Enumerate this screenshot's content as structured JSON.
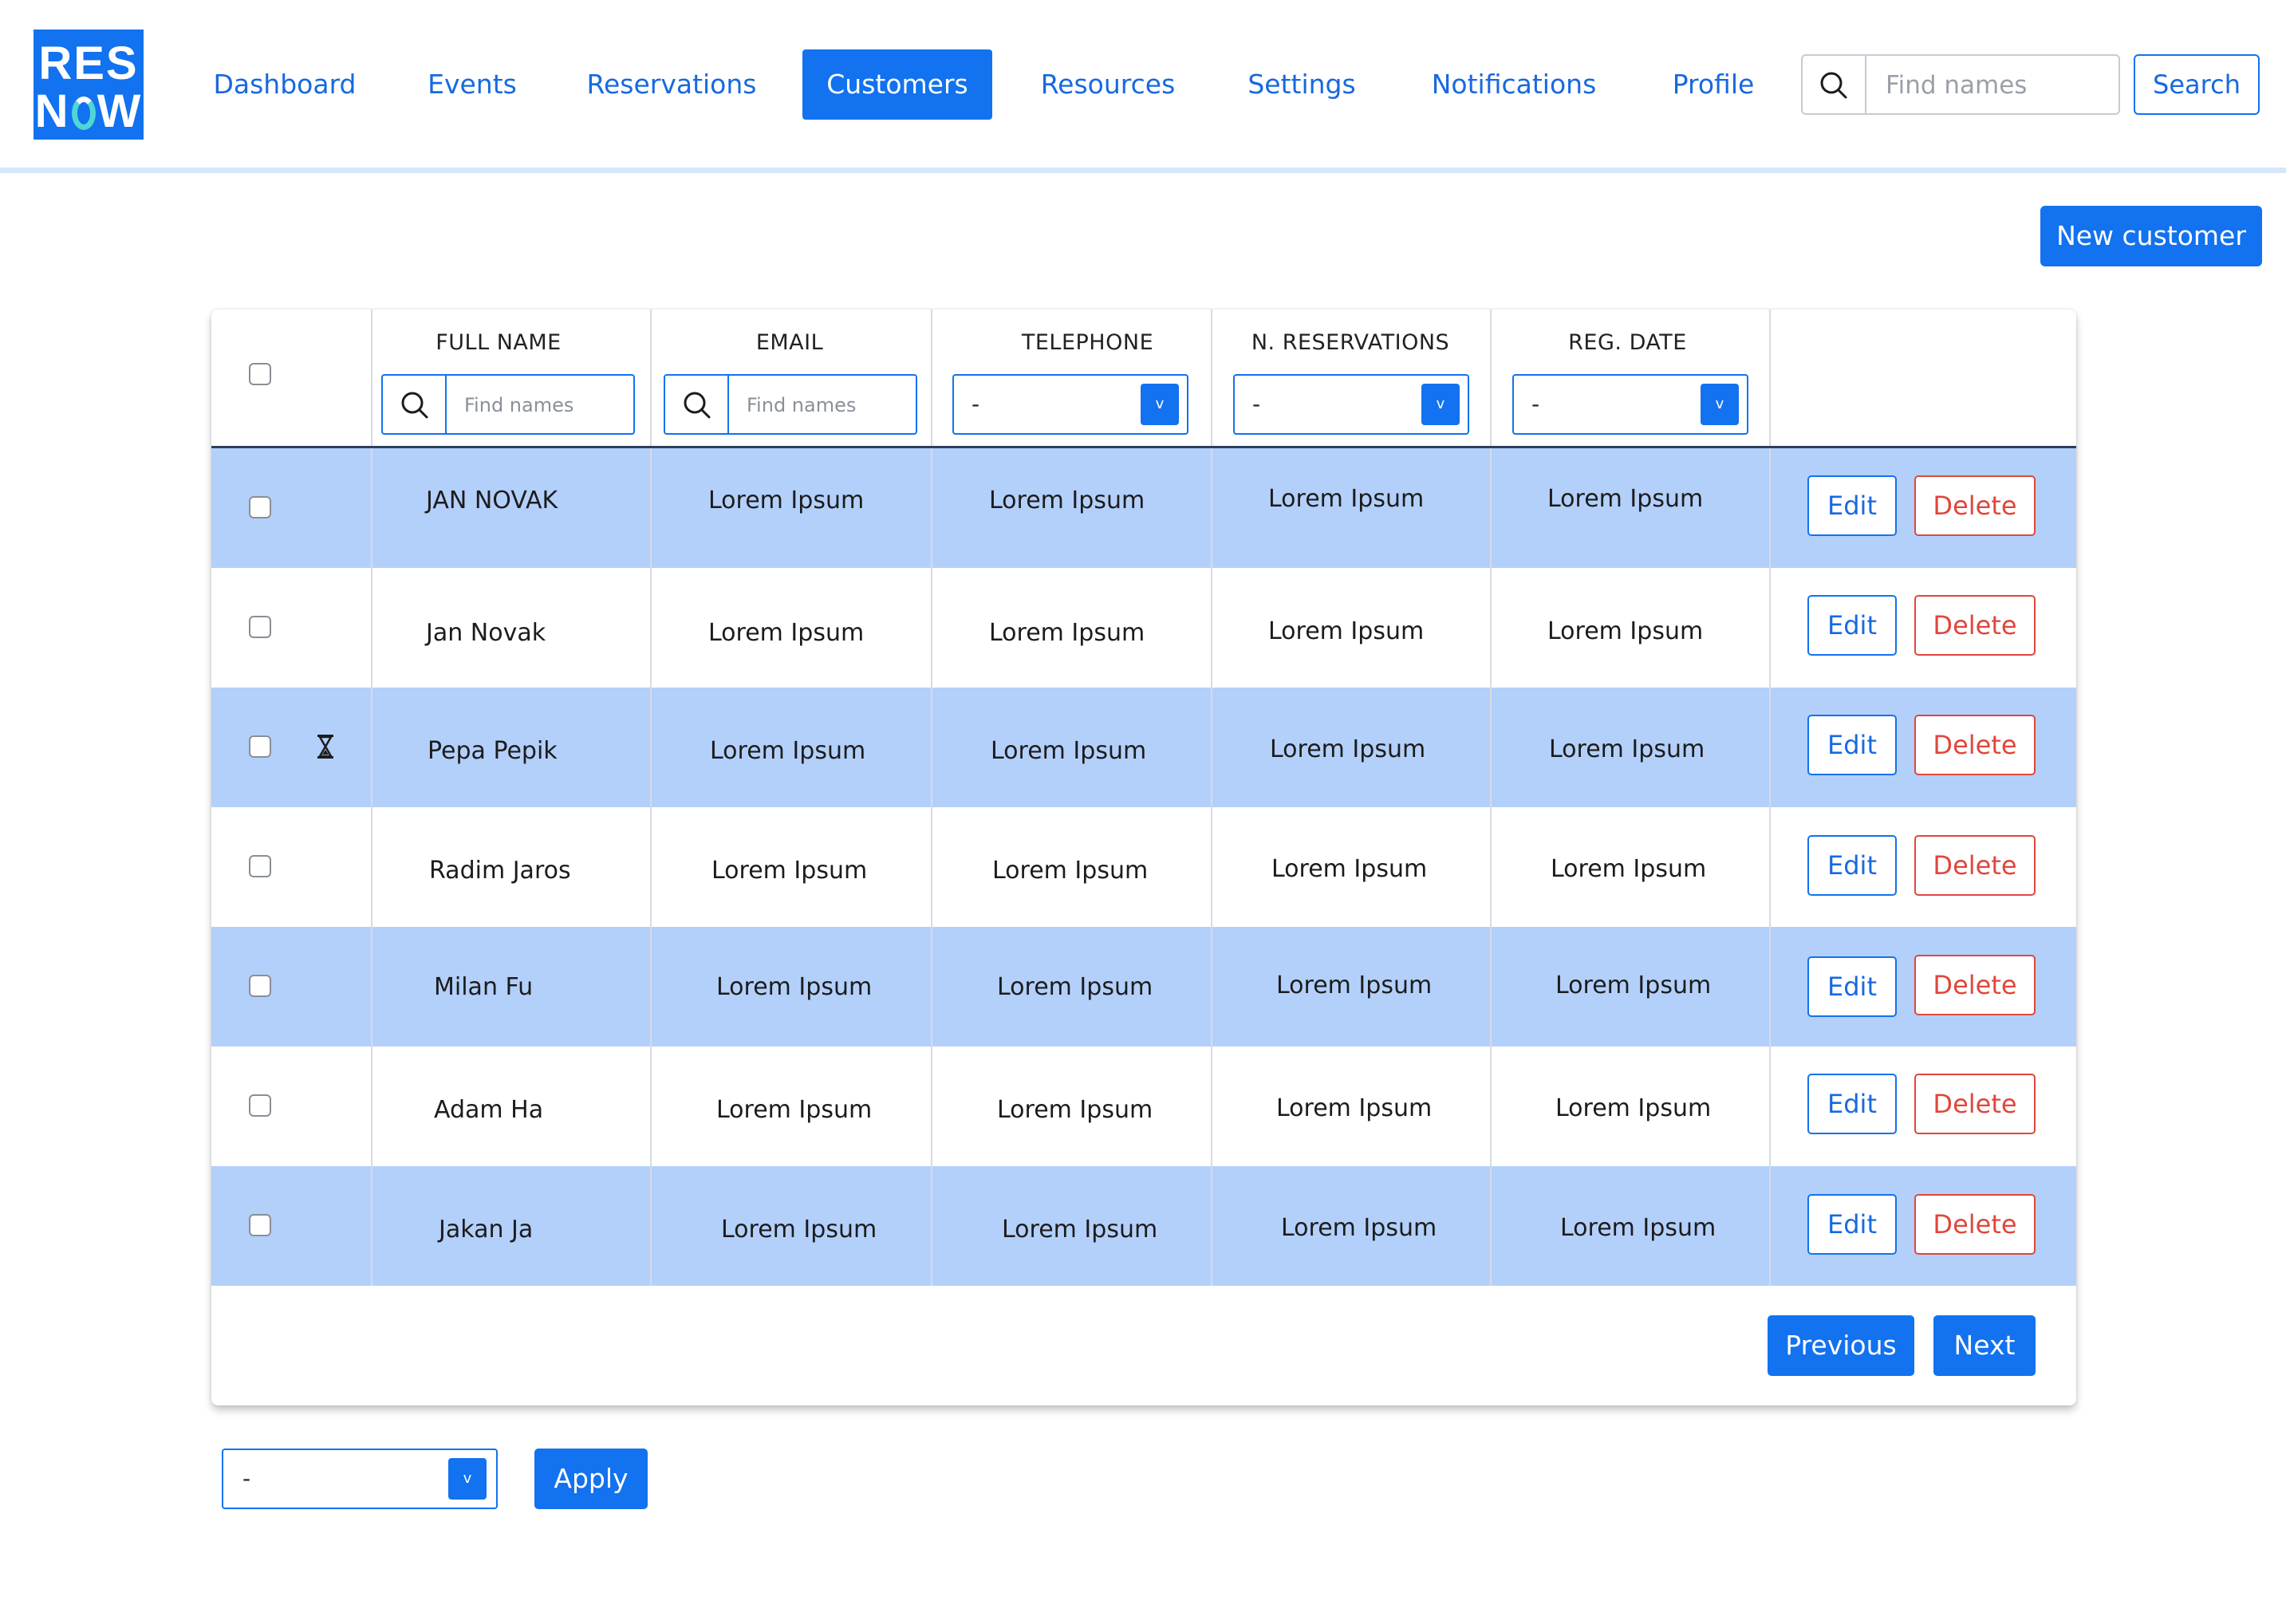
{
  "brand": {
    "logo_line1": "RES",
    "logo_line2_a": "N",
    "logo_line2_b": "W"
  },
  "nav": {
    "items": [
      "Dashboard",
      "Events",
      "Reservations",
      "Customers",
      "Resources",
      "Settings",
      "Notifications",
      "Profile"
    ],
    "active": "Customers"
  },
  "top_search": {
    "placeholder": "Find names",
    "button": "Search"
  },
  "actions": {
    "new_customer": "New customer"
  },
  "table": {
    "columns": [
      "FULL NAME",
      "EMAIL",
      "TELEPHONE",
      "N. RESERVATIONS",
      "REG. DATE"
    ],
    "filters": {
      "name_placeholder": "Find names",
      "email_placeholder": "Find names",
      "telephone_value": "-",
      "reservations_value": "-",
      "reg_date_value": "-"
    },
    "rows": [
      {
        "name": "JAN NOVAK",
        "email": "Lorem Ipsum",
        "telephone": "Lorem Ipsum",
        "reservations": "Lorem Ipsum",
        "reg_date": "Lorem Ipsum"
      },
      {
        "name": "Jan Novak",
        "email": "Lorem Ipsum",
        "telephone": "Lorem Ipsum",
        "reservations": "Lorem Ipsum",
        "reg_date": "Lorem Ipsum"
      },
      {
        "name": "Pepa Pepik",
        "email": "Lorem Ipsum",
        "telephone": "Lorem Ipsum",
        "reservations": "Lorem Ipsum",
        "reg_date": "Lorem Ipsum",
        "status_icon": "hourglass-icon"
      },
      {
        "name": "Radim Jaros",
        "email": "Lorem Ipsum",
        "telephone": "Lorem Ipsum",
        "reservations": "Lorem Ipsum",
        "reg_date": "Lorem Ipsum"
      },
      {
        "name": "Milan Fu",
        "email": "Lorem Ipsum",
        "telephone": "Lorem Ipsum",
        "reservations": "Lorem Ipsum",
        "reg_date": "Lorem Ipsum"
      },
      {
        "name": "Adam Ha",
        "email": "Lorem Ipsum",
        "telephone": "Lorem Ipsum",
        "reservations": "Lorem Ipsum",
        "reg_date": "Lorem Ipsum"
      },
      {
        "name": "Jakan Ja",
        "email": "Lorem Ipsum",
        "telephone": "Lorem Ipsum",
        "reservations": "Lorem Ipsum",
        "reg_date": "Lorem Ipsum"
      }
    ],
    "row_actions": {
      "edit": "Edit",
      "delete": "Delete"
    },
    "pagination": {
      "previous": "Previous",
      "next": "Next"
    }
  },
  "bulk": {
    "select_value": "-",
    "apply": "Apply",
    "dropdown_glyph": "v"
  },
  "colors": {
    "accent": "#1272ef",
    "row_highlight": "#b3d0fb",
    "danger": "#e0463c",
    "header_rule": "#d6e6fb"
  }
}
